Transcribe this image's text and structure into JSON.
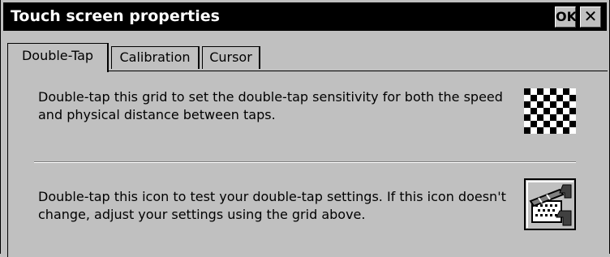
{
  "window": {
    "title": "Touch screen properties",
    "ok_label": "OK",
    "close_icon": "close-icon"
  },
  "tabs": [
    {
      "label": "Double-Tap",
      "selected": true
    },
    {
      "label": "Calibration",
      "selected": false
    },
    {
      "label": "Cursor",
      "selected": false
    }
  ],
  "doubletap": {
    "grid_text": "Double-tap this grid to set the double-tap sensitivity for both the speed and physical distance between taps.",
    "grid_icon": "checkerboard-grid-icon",
    "test_text": "Double-tap this icon to test your double-tap settings. If this icon doesn't change, adjust your settings using the grid above.",
    "test_icon": "clapperboard-icon"
  },
  "colors": {
    "window_bg": "#c0c0c0",
    "titlebar_bg": "#000000",
    "title_text": "#ffffff"
  }
}
